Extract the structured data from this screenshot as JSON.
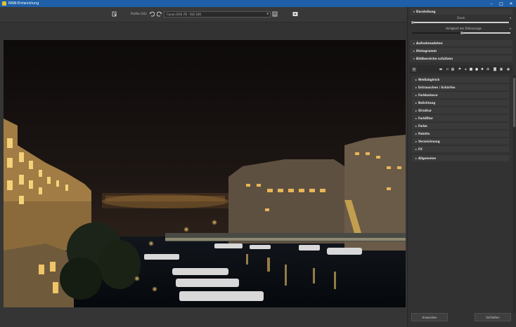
{
  "window": {
    "title": "RAW-Entwicklung",
    "minimize": "–",
    "maximize": "□",
    "close": "✕",
    "colors": {
      "titlebar": "#1e5fa8",
      "panel": "#323232",
      "canvas_bg": "#353535"
    }
  },
  "toolbar": {
    "profile_label": "Profile (16):",
    "profile_value": "Canon EOS 7D - ISO 100",
    "icons": [
      "import-icon",
      "undo-icon",
      "redo-icon",
      "list-icon",
      "play-icon"
    ]
  },
  "panel": {
    "sections": {
      "darstellung": "Darstellung",
      "aufnahmedaten": "Aufnahmedaten",
      "histogramm": "Histogramm",
      "bildbereiche": "Bildbereiche schützen"
    },
    "sliders": {
      "zoom_label": "Zoom",
      "helligkeit_label": "Helligkeit der Bildanzeige"
    },
    "tool_icons": [
      "plus-icon",
      "line-icon",
      "crop-icon",
      "grid-icon",
      "flag-icon",
      "sound-icon",
      "square-icon",
      "circle-icon",
      "sun-icon",
      "crosshair-icon",
      "camera-icon",
      "image-icon",
      "eye-icon"
    ],
    "tools": [
      "Weißabgleich",
      "Entrauschen / Schärfen",
      "Farbbalance",
      "Belichtung",
      "Struktur",
      "Farbfilter",
      "Farbe",
      "Palette",
      "Verzeichnung",
      "FX",
      "Allgemeine"
    ]
  },
  "buttons": {
    "apply": "Anwenden",
    "close": "Schließen"
  }
}
